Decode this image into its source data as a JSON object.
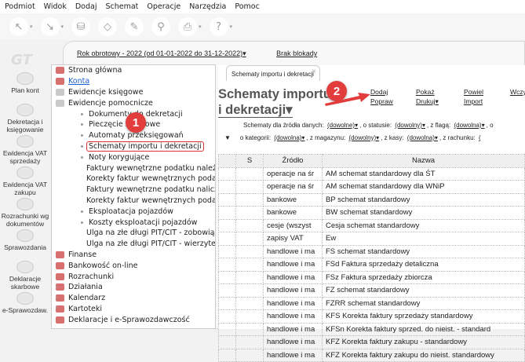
{
  "menu": [
    "Podmiot",
    "Widok",
    "Dodaj",
    "Schemat",
    "Operacje",
    "Narzędzia",
    "Pomoc"
  ],
  "toolbar_icons": [
    "back-icon",
    "forward-icon",
    "accounts-icon",
    "document-icon",
    "edit-icon",
    "stamp-icon",
    "print-icon",
    "help-icon"
  ],
  "logo": "GT",
  "year_bar": {
    "year": "Rok obrotowy - 2022  (od 01-01-2022 do 31-12-2022)▾",
    "lock": "Brak blokady"
  },
  "left_bar": [
    "Plan kont",
    "Dekretacja i księgowanie",
    "Ewidencja VAT sprzedaży",
    "Ewidencja VAT zakupu",
    "Rozrachunki wg dokumentów",
    "Sprawozdania",
    "Deklaracje skarbowe",
    "e-Sprawozdaw."
  ],
  "tree": {
    "top": [
      "Strona główna",
      "Konta",
      "Ewidencje księgowe",
      "Ewidencje pomocnicze"
    ],
    "sub": [
      "Dokumenty do dekretacji",
      "Pieczęcie księgowe",
      "Automaty przeksięgowań",
      "Schematy importu i dekretacji",
      "Noty korygujące",
      "Faktury wewnętrzne podatku należne",
      "Korekty faktur wewnętrznych podatku",
      "Faktury wewnętrzne podatku naliczon",
      "Korekty faktur wewnętrznych podatku",
      "Eksploatacja pojazdów",
      "Koszty eksploatacji pojazdów",
      "Ulga na złe długi PIT/CIT - zobowiąza",
      "Ulga na złe długi PIT/CIT - wierzytelno"
    ],
    "bottom": [
      "Finanse",
      "Bankowość on-line",
      "Rozrachunki",
      "Działania",
      "Kalendarz",
      "Kartoteki",
      "Deklaracje i e-Sprawozdawczość"
    ],
    "selected": "Schematy importu i dekretacji"
  },
  "tab": {
    "label": "Schematy importu i dekretacji",
    "close": "×"
  },
  "title": {
    "line1": "Schematy importu",
    "line2": "i dekretacji▾"
  },
  "actions": {
    "dodaj": "Dodaj",
    "popraw": "Popraw",
    "pokaz": "Pokaż",
    "drukuj": "Drukuj▾",
    "powiel": "Powiel",
    "import": "Import",
    "wczytaj": "Wczy"
  },
  "filters": {
    "row1": {
      "l1": "Schematy dla źródła danych:",
      "v1": "(dowolne)▾",
      "l2": ", o statusie:",
      "v2": "(dowolny)▾",
      "l3": ", z flagą:",
      "v3": "(dowolna)▾",
      "l4": ", o"
    },
    "row2": {
      "l1": "o kategorii:",
      "v1": "(dowolna)▾",
      "l2": ", z magazynu:",
      "v2": "(dowolny)▾",
      "l3": ", z kasy:",
      "v3": "(dowolna)▾",
      "l4": ", z rachunku:",
      "v4": "("
    }
  },
  "annotations": {
    "one": "1",
    "two": "2",
    "accent": "#e23c3c"
  },
  "table": {
    "headers": [
      "",
      "S",
      "Źródło",
      "Nazwa"
    ],
    "rows": [
      [
        "operacje na śr",
        "AM schemat standardowy dla ŚT"
      ],
      [
        "operacje na śr",
        "AM schemat standardowy dla WNiP"
      ],
      [
        "bankowe",
        "BP schemat standardowy"
      ],
      [
        "bankowe",
        "BW schemat standardowy"
      ],
      [
        "cesje (wszyst",
        "Cesja schemat standardowy"
      ],
      [
        "zapisy VAT",
        "Ew"
      ],
      [
        "handlowe i ma",
        "FS schemat standardowy"
      ],
      [
        "handlowe i ma",
        "FSd Faktura sprzedaży detaliczna"
      ],
      [
        "handlowe i ma",
        "FSz Faktura sprzedaży zbiorcza"
      ],
      [
        "handlowe i ma",
        "FZ schemat standardowy"
      ],
      [
        "handlowe i ma",
        "FZRR schemat standardowy"
      ],
      [
        "handlowe i ma",
        "KFS Korekta faktury sprzedaży standardowy"
      ],
      [
        "handlowe i ma",
        "KFSn Korekta faktury sprzed. do nieist. - standard"
      ],
      [
        "handlowe i ma",
        "KFZ Korekta faktury zakupu - standardowy"
      ],
      [
        "handlowe i ma",
        "KFZ Korekta faktury zakupu do nieist. standardowy"
      ]
    ]
  }
}
